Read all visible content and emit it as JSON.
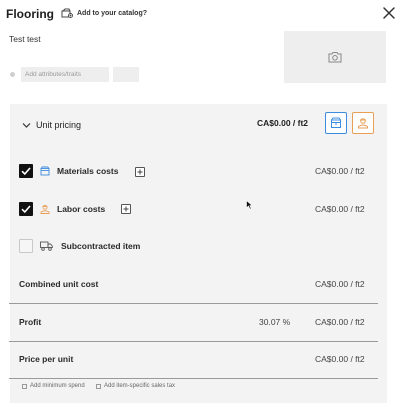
{
  "header": {
    "title": "Flooring",
    "catalog_label": "Add to your catalog?"
  },
  "item": {
    "name": "Test test",
    "attributes_placeholder": "Add attributes/traits"
  },
  "unit_pricing": {
    "label": "Unit pricing",
    "value": "CA$0.00  / ft2"
  },
  "cost_rows": [
    {
      "label": "Materials costs",
      "value": "CA$0.00  / ft2",
      "checked": true
    },
    {
      "label": "Labor costs",
      "value": "CA$0.00  / ft2",
      "checked": true
    },
    {
      "label": "Subcontracted item",
      "checked": false
    }
  ],
  "combined": {
    "label": "Combined unit cost",
    "value": "CA$0.00  / ft2"
  },
  "profit": {
    "label": "Profit",
    "percent": "30.07 %",
    "value": "CA$0.00  / ft2"
  },
  "price_per_unit": {
    "label": "Price per unit",
    "value": "CA$0.00  / ft2"
  },
  "footer": {
    "min_spend": "Add minimum spend",
    "sales_tax": "Add item-specific sales tax"
  },
  "colors": {
    "materials_accent": "#3d8ce0",
    "labor_accent": "#e8a058"
  }
}
